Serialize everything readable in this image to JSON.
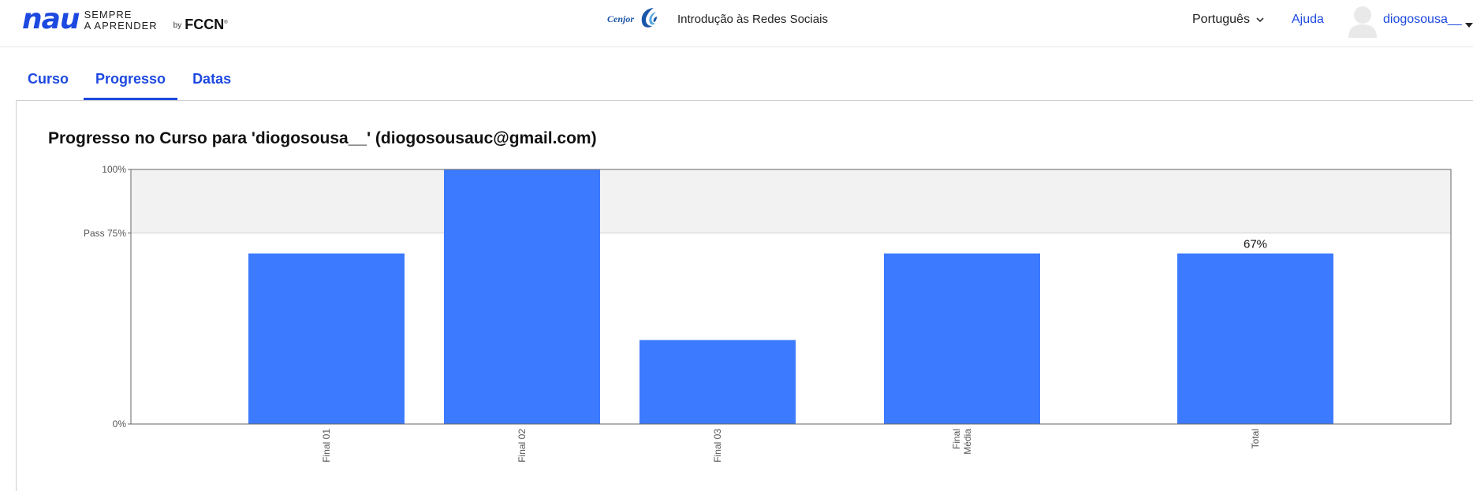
{
  "header": {
    "brand_logo": "nau",
    "brand_line1": "SEMPRE",
    "brand_line2": "A APRENDER",
    "brand_by": "by",
    "brand_fccn": "FCCN",
    "partner_name": "Cenjor",
    "course_title": "Introdução às Redes Sociais",
    "language": "Português",
    "help": "Ajuda",
    "username": "diogosousa__"
  },
  "tabs": [
    {
      "label": "Curso",
      "active": false
    },
    {
      "label": "Progresso",
      "active": true
    },
    {
      "label": "Datas",
      "active": false
    }
  ],
  "progress": {
    "title": "Progresso no Curso para 'diogosousa__' (diogosousauc@gmail.com)"
  },
  "colors": {
    "accent": "#1d49e0",
    "bar": "#3877ff",
    "pass_band": "#f2f2f2"
  },
  "chart_data": {
    "type": "bar",
    "categories": [
      "Final 01",
      "Final 02",
      "Final 03",
      "Final\nMédia",
      "Total"
    ],
    "values": [
      67,
      100,
      33,
      67,
      67
    ],
    "ylim": [
      0,
      100
    ],
    "y_ticks": [
      {
        "value": 0,
        "label": "0%"
      },
      {
        "value": 75,
        "label": "Pass 75%"
      },
      {
        "value": 100,
        "label": "100%"
      }
    ],
    "pass_threshold": 75,
    "data_labels": [
      {
        "category": "Total",
        "label": "67%"
      }
    ]
  }
}
